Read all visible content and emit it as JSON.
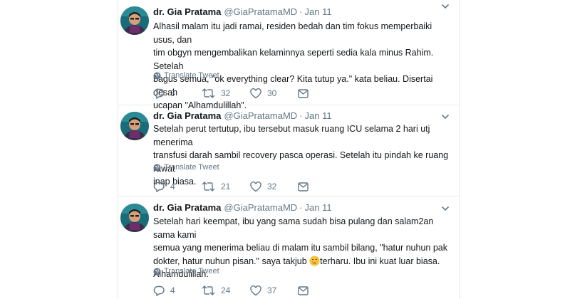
{
  "tweets": [
    {
      "name": "dr. Gia Pratama",
      "handle": "@GiaPratamaMD",
      "separator": "·",
      "date": "Jan 11",
      "text": "Alhasil malam itu jadi ramai, residen bedah dan tim fokus memperbaiki usus, dan\ntim obgyn mengembalikan kelaminnya seperti sedia kala minus Rahim. Setelah\nbagus semua, \"ok everything clear? Kita tutup ya.\" kata beliau. Disertai desah\nucapan \"Alhamdulillah\".",
      "translate": "Translate Tweet",
      "replies": "3",
      "retweets": "32",
      "likes": "30"
    },
    {
      "name": "dr. Gia Pratama",
      "handle": "@GiaPratamaMD",
      "separator": "·",
      "date": "Jan 11",
      "text": "Setelah perut tertutup, ibu tersebut masuk ruang ICU selama 2 hari utj menerima\ntransfusi darah sambil recovery pasca operasi. Setelah itu pindah ke ruang rawat\ninap biasa.",
      "translate": "Translate Tweet",
      "replies": "4",
      "retweets": "21",
      "likes": "32"
    },
    {
      "name": "dr. Gia Pratama",
      "handle": "@GiaPratamaMD",
      "separator": "·",
      "date": "Jan 11",
      "text_before_emoji": "Setelah hari keempat, ibu yang sama sudah bisa pulang dan salam2an sama kami\nsemua yang menerima beliau di malam itu sambil bilang, \"hatur nuhun pak\ndokter, hatur nuhun pisan.\" saya takjub ",
      "text_after_emoji": "terharu. Ibu ini kuat luar biasa.\nAlhamdulillah.",
      "translate": "Translate Tweet",
      "replies": "4",
      "retweets": "24",
      "likes": "37"
    }
  ],
  "colors": {
    "text": "#14171a",
    "secondary": "#657786",
    "divider": "#e6ecf0",
    "avatar_bg": "#1a6c78"
  },
  "icons": [
    "caret-down-icon",
    "globe-icon",
    "reply-icon",
    "retweet-icon",
    "like-icon",
    "message-icon",
    "crying-face-emoji"
  ]
}
